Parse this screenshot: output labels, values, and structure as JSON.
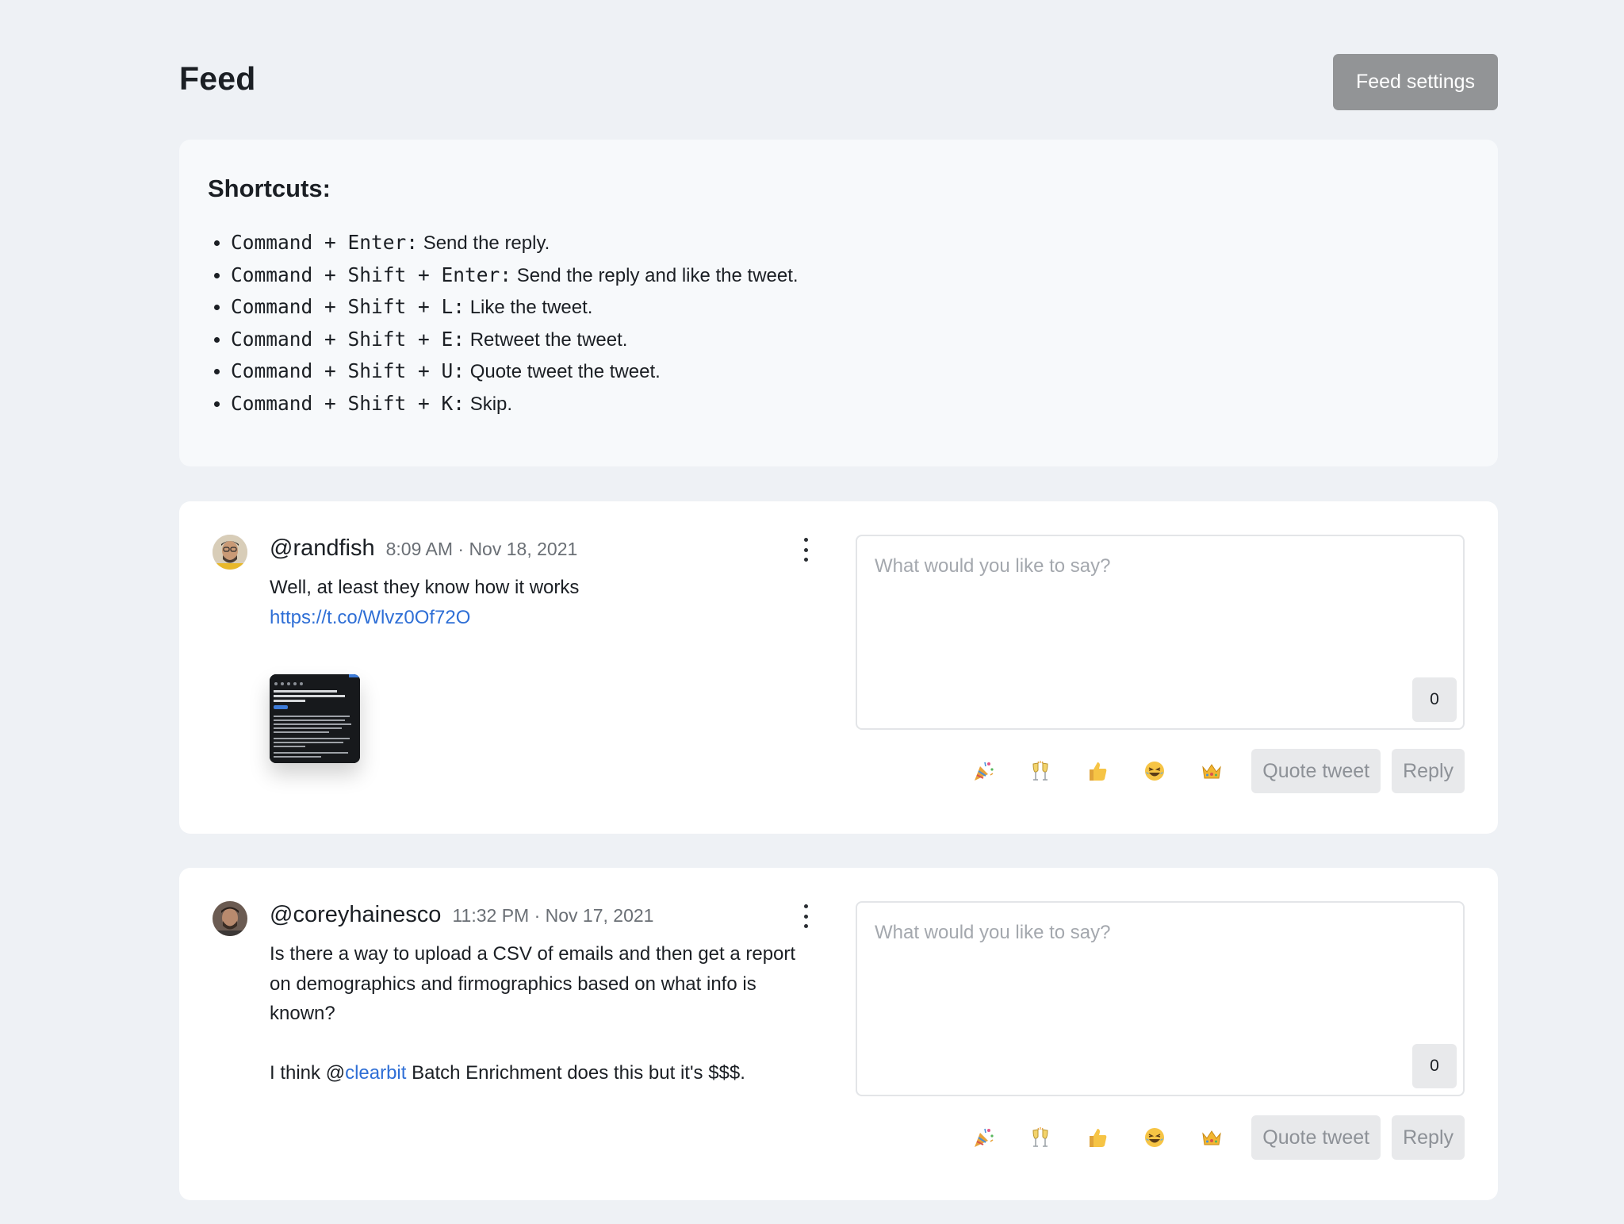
{
  "header": {
    "title": "Feed",
    "settings_label": "Feed settings"
  },
  "shortcuts": {
    "title": "Shortcuts:",
    "items": [
      {
        "keys": "Command + Enter:",
        "desc": "Send the reply."
      },
      {
        "keys": "Command + Shift + Enter:",
        "desc": "Send the reply and like the tweet."
      },
      {
        "keys": "Command + Shift + L:",
        "desc": "Like the tweet."
      },
      {
        "keys": "Command + Shift + E:",
        "desc": "Retweet the tweet."
      },
      {
        "keys": "Command + Shift + U:",
        "desc": "Quote tweet the tweet."
      },
      {
        "keys": "Command + Shift + K:",
        "desc": "Skip."
      }
    ]
  },
  "reply_placeholder": "What would you like to say?",
  "emoji_buttons": [
    "party-popper-icon",
    "clinking-glasses-icon",
    "thumbs-up-icon",
    "laughing-face-icon",
    "crown-icon"
  ],
  "quote_label": "Quote tweet",
  "reply_label": "Reply",
  "tweets": [
    {
      "handle": "@randfish",
      "time": "8:09 AM · Nov 18, 2021",
      "text": "Well, at least they know how it works",
      "link": "https://t.co/Wlvz0Of72O",
      "char_count": "0"
    },
    {
      "handle": "@coreyhainesco",
      "time": "11:32 PM · Nov 17, 2021",
      "text_para1": "Is there a way to upload a CSV of emails and then get a report on demographics and firmographics based on what info is known?",
      "text_para2_prefix": "I think @",
      "mention": "clearbit",
      "text_para2_suffix": " Batch Enrichment does this but it's $$$.",
      "char_count": "0"
    }
  ],
  "colors": {
    "background": "#eef1f5",
    "link": "#2f6fd6",
    "settings_button": "#929496"
  }
}
